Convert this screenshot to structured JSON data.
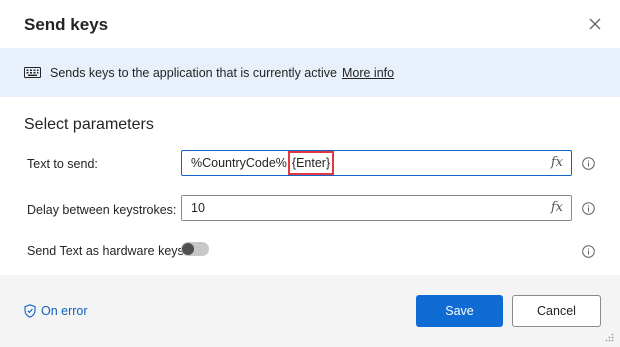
{
  "dialog": {
    "title": "Send keys",
    "close_icon": "close-icon"
  },
  "info": {
    "icon": "keyboard-icon",
    "text": "Sends keys to the application that is currently active",
    "link": "More info"
  },
  "section": {
    "title": "Select parameters"
  },
  "fields": {
    "text_to_send": {
      "label": "Text to send:",
      "value_prefix": "%CountryCode%",
      "value_highlight": "{Enter}",
      "fx": "fx"
    },
    "delay": {
      "label": "Delay between keystrokes:",
      "value": "10",
      "fx": "fx"
    },
    "hardware_keys": {
      "label": "Send Text as hardware keys:",
      "enabled": false
    }
  },
  "footer": {
    "on_error": "On error",
    "save": "Save",
    "cancel": "Cancel"
  },
  "colors": {
    "accent": "#0f6cd4",
    "info_bg": "#e8f0fb",
    "highlight": "#e0393e",
    "footer_bg": "#f4f4f4"
  }
}
